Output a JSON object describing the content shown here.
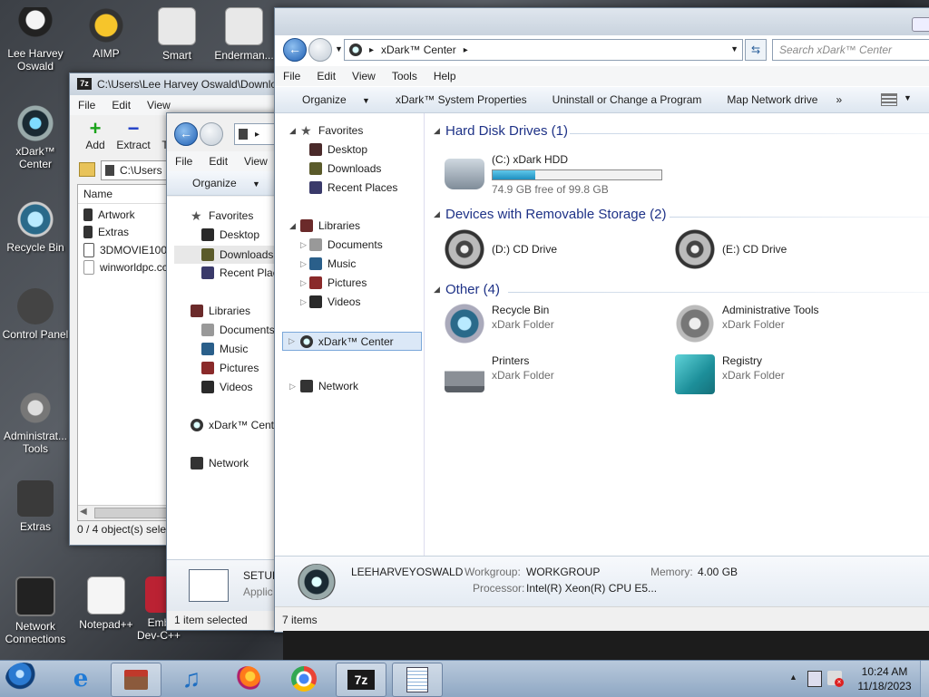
{
  "desktop": {
    "icons": [
      {
        "label": "Lee Harvey\nOswald"
      },
      {
        "label": "AIMP"
      },
      {
        "label": "Smart"
      },
      {
        "label": "Enderman..."
      },
      {
        "label": "xDark™\nCenter"
      },
      {
        "label": "Recycle Bin"
      },
      {
        "label": "Control Panel"
      },
      {
        "label": "Administrat...\nTools"
      },
      {
        "label": "Extras"
      },
      {
        "label": "Network\nConnections"
      },
      {
        "label": "Notepad++"
      },
      {
        "label": "Emb\nDev-C++"
      }
    ]
  },
  "sevenzip": {
    "title": "C:\\Users\\Lee Harvey Oswald\\Downlo",
    "menu": [
      "File",
      "Edit",
      "View"
    ],
    "tools": [
      {
        "label": "Add"
      },
      {
        "label": "Extract"
      },
      {
        "label": "T"
      }
    ],
    "path": "C:\\Users",
    "column": "Name",
    "files": [
      "Artwork",
      "Extras",
      "3DMOVIE100.i",
      "winworldpc.cc"
    ],
    "status": "0 / 4 object(s) selec"
  },
  "explorer2": {
    "menu": [
      "File",
      "Edit",
      "View"
    ],
    "organize": "Organize",
    "tree": [
      "Favorites",
      "Desktop",
      "Downloads",
      "Recent Plac",
      "Libraries",
      "Documents",
      "Music",
      "Pictures",
      "Videos",
      "xDark™ Cente",
      "Network"
    ],
    "details_name": "SETUP",
    "details_sub": "Applic",
    "status": "1 item selected"
  },
  "main": {
    "breadcrumb": "xDark™ Center",
    "search_placeholder": "Search xDark™ Center",
    "menu": [
      "File",
      "Edit",
      "View",
      "Tools",
      "Help"
    ],
    "commands": [
      "Organize",
      "xDark™ System Properties",
      "Uninstall or Change a Program",
      "Map Network drive",
      "»"
    ],
    "tree": {
      "favorites": "Favorites",
      "desktop": "Desktop",
      "downloads": "Downloads",
      "recent": "Recent Places",
      "libraries": "Libraries",
      "documents": "Documents",
      "music": "Music",
      "pictures": "Pictures",
      "videos": "Videos",
      "center": "xDark™ Center",
      "network": "Network"
    },
    "sections": {
      "hdd": "Hard Disk Drives (1)",
      "removable": "Devices with Removable Storage (2)",
      "other": "Other (4)"
    },
    "drive_c": {
      "name": "(C:) xDark HDD",
      "free": "74.9 GB free of 99.8 GB",
      "used_fraction": 0.25
    },
    "drive_d": "(D:) CD Drive",
    "drive_e": "(E:) CD Drive",
    "others": [
      {
        "name": "Recycle Bin",
        "sub": "xDark Folder"
      },
      {
        "name": "Administrative Tools",
        "sub": "xDark Folder"
      },
      {
        "name": "Printers",
        "sub": "xDark Folder"
      },
      {
        "name": "Registry",
        "sub": "xDark Folder"
      }
    ],
    "details": {
      "computer": "LEEHARVEYOSWALD",
      "workgroup_label": "Workgroup:",
      "workgroup": "WORKGROUP",
      "memory_label": "Memory:",
      "memory": "4.00 GB",
      "processor_label": "Processor:",
      "processor": "Intel(R) Xeon(R) CPU E5..."
    },
    "status": "7 items"
  },
  "taskbar": {
    "time": "10:24 AM",
    "date": "11/18/2023",
    "apps": [
      "start-orb",
      "internet-explorer",
      "store",
      "music",
      "firefox",
      "chrome",
      "7zip",
      "notepad"
    ]
  }
}
